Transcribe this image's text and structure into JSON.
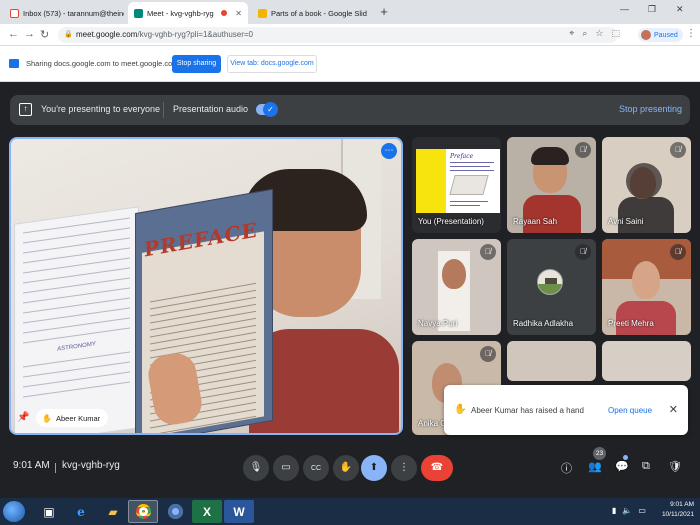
{
  "browser": {
    "tabs": [
      {
        "title": "Inbox (573) - tarannum@theinde",
        "active": false,
        "favicon_color": "#ea4335"
      },
      {
        "title": "Meet - kvg-vghb-ryg",
        "active": true,
        "favicon_color": "#00897b"
      },
      {
        "title": "Parts of a book - Google Slid",
        "active": false,
        "favicon_color": "#f4b400"
      }
    ],
    "new_tab_label": "+",
    "url_host": "meet.google.com",
    "url_path": "/kvg-vghb-ryg?pli=1&authuser=0",
    "profile_status": "Paused"
  },
  "sharing_bar": {
    "text": "Sharing docs.google.com to meet.google.com",
    "stop_sharing_label": "Stop sharing",
    "view_tab_label": "View tab: docs.google.com"
  },
  "presenting_bar": {
    "status_text": "You're presenting to everyone",
    "audio_label": "Presentation audio",
    "audio_on": true,
    "stop_label": "Stop presenting"
  },
  "main_tile": {
    "participant_name": "Abeer Kumar",
    "book_heading": "PREFACE",
    "book_section": "ASTRONOMY"
  },
  "participants": [
    {
      "name": "You (Presentation)",
      "kind": "slide",
      "muted": false
    },
    {
      "name": "Rayaan Sah",
      "kind": "video",
      "muted": true
    },
    {
      "name": "Avni Saini",
      "kind": "video",
      "muted": true
    },
    {
      "name": "Navya Puri",
      "kind": "video",
      "muted": true
    },
    {
      "name": "Radhika Adlakha",
      "kind": "avatar",
      "muted": true
    },
    {
      "name": "Preeti Mehra",
      "kind": "video",
      "muted": true
    },
    {
      "name": "Anika Gu",
      "kind": "video",
      "muted": true
    }
  ],
  "slide_thumb": {
    "title": "Preface"
  },
  "toast": {
    "text": "Abeer Kumar has raised a hand",
    "action_label": "Open queue"
  },
  "controls": {
    "time": "9:01 AM",
    "meeting_code": "kvg-vghb-ryg",
    "participant_count": "23"
  },
  "taskbar": {
    "time": "9:01 AM",
    "date": "10/11/2021"
  },
  "colors": {
    "accent_blue": "#1a73e8",
    "meet_dark": "#202124",
    "leave_red": "#ea4335"
  }
}
